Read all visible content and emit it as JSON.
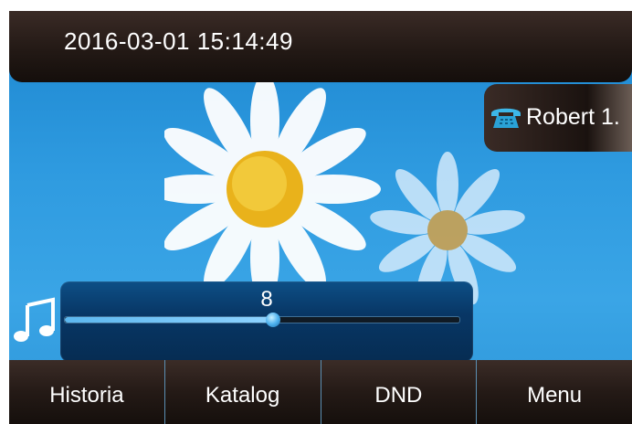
{
  "status_bar": {
    "datetime": "2016-03-01 15:14:49"
  },
  "account": {
    "label": "Robert 1.",
    "icon": "phone-icon"
  },
  "volume": {
    "value": "8",
    "level_fraction": 0.53,
    "icon": "music-note-icon"
  },
  "softkeys": [
    {
      "label": "Historia"
    },
    {
      "label": "Katalog"
    },
    {
      "label": "DND"
    },
    {
      "label": "Menu"
    }
  ],
  "colors": {
    "bar_dark": "#231915",
    "sky_blue": "#2f9be0",
    "volume_panel": "#083766",
    "accent_blue": "#4fb2ef"
  }
}
